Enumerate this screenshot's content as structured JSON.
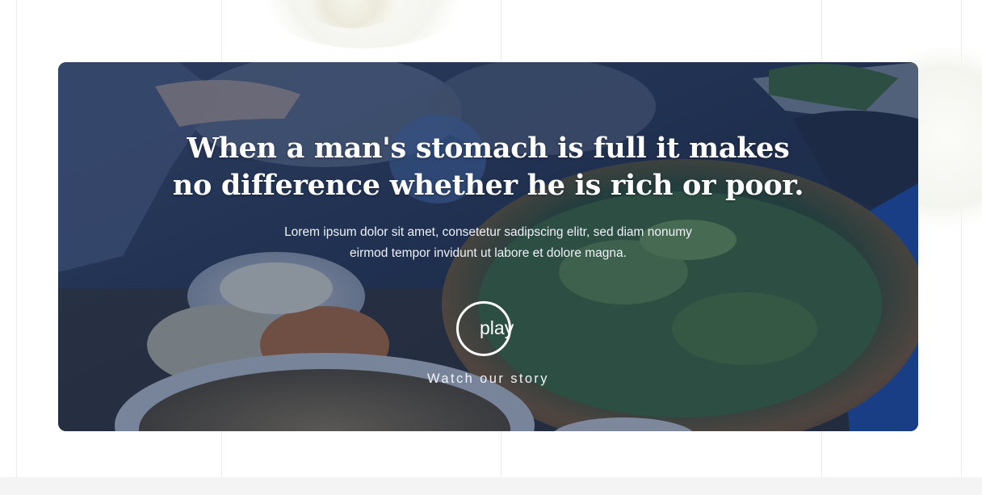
{
  "hero": {
    "title": "When a man's stomach is full it makes no difference whether he is rich or poor.",
    "description": "Lorem ipsum dolor sit amet, consetetur sadipscing elitr, sed diam nonumy eirmod tempor invidunt ut labore et dolore magna.",
    "play_label": "play",
    "watch_label": "Watch our story",
    "overlay_color": "#16284E",
    "accent_text_color": "#FFFFFF"
  }
}
